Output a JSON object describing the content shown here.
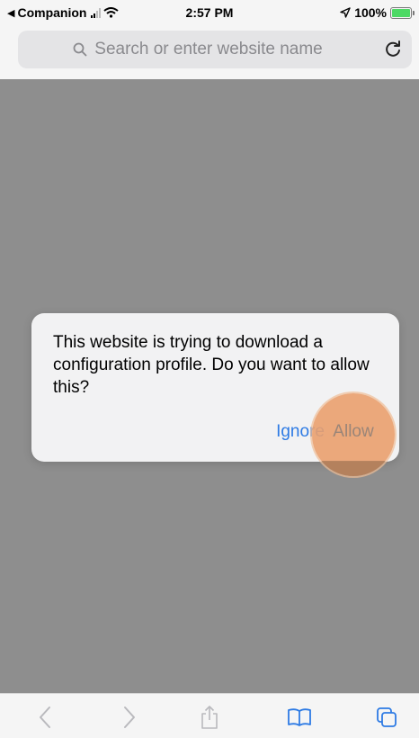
{
  "status_bar": {
    "back_app": "Companion",
    "time": "2:57 PM",
    "battery": "100%"
  },
  "url_bar": {
    "placeholder": "Search or enter website name",
    "icons": [
      "search-icon",
      "reload-icon"
    ]
  },
  "alert": {
    "message": "This website is trying to download a configuration profile. Do you want to allow this?",
    "ignore_label": "Ignore",
    "allow_label": "Allow"
  },
  "bottom_toolbar": {
    "icons": [
      "back-icon",
      "forward-icon",
      "share-icon",
      "bookmarks-icon",
      "tabs-icon"
    ]
  },
  "colors": {
    "accent": "#2e7be4",
    "tap_highlight": "#eaa06e",
    "overlay": "#8e8e8e"
  }
}
